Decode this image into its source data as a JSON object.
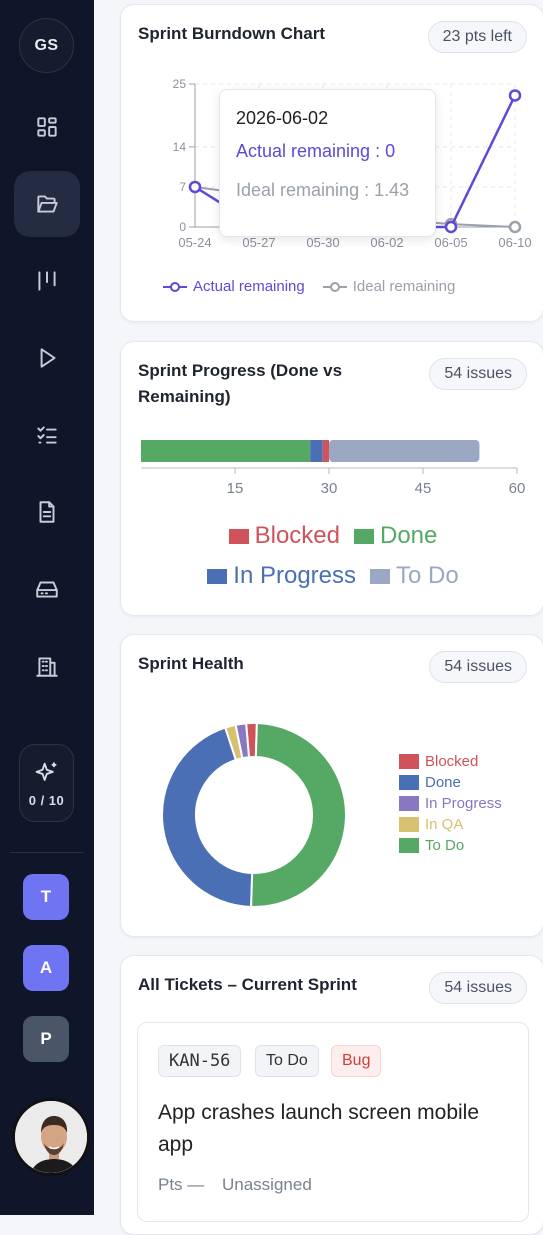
{
  "sidebar": {
    "user_initials": "GS",
    "ai_counter": "0 / 10",
    "projects": [
      "T",
      "A",
      "P"
    ]
  },
  "burndown": {
    "title": "Sprint Burndown Chart",
    "badge": "23 pts left",
    "tooltip": {
      "date": "2026-06-02",
      "actual": "Actual remaining : 0",
      "ideal": "Ideal remaining : 1.43"
    },
    "legend": {
      "actual": "Actual remaining",
      "ideal": "Ideal remaining"
    }
  },
  "progress": {
    "title_line1": "Sprint Progress (Done vs",
    "title_line2": "Remaining)",
    "badge": "54 issues",
    "legend": [
      "Blocked",
      "Done",
      "In Progress",
      "To Do"
    ]
  },
  "health": {
    "title": "Sprint Health",
    "badge": "54 issues",
    "legend": [
      "Blocked",
      "Done",
      "In Progress",
      "In QA",
      "To Do"
    ]
  },
  "tickets": {
    "title": "All Tickets – Current Sprint",
    "badge": "54 issues",
    "first": {
      "key": "KAN-56",
      "status": "To Do",
      "type": "Bug",
      "summary_line1": "App crashes launch screen mobile",
      "summary_line2": "app",
      "points": "Pts —",
      "assignee": "Unassigned"
    }
  },
  "colors": {
    "blocked": "#d0525a",
    "done": "#56a865",
    "in_progress": "#4b6fb5",
    "to_do": "#9aa8c3",
    "in_qa": "#d6c170",
    "accent": "#5b4bd6",
    "sidebar_bg": "#0f1629"
  },
  "chart_data": [
    {
      "type": "line",
      "x": [
        "05-24",
        "05-27",
        "05-30",
        "06-02",
        "06-05",
        "06-10"
      ],
      "ylim": [
        0,
        25
      ],
      "yticks": [
        0,
        7,
        14,
        25
      ],
      "series": [
        {
          "name": "Actual remaining",
          "values": [
            7,
            0,
            0,
            0,
            0,
            23
          ]
        },
        {
          "name": "Ideal remaining",
          "values": [
            7,
            5.5,
            3,
            1.43,
            0.5,
            0
          ]
        }
      ]
    },
    {
      "type": "bar",
      "orientation": "horizontal-stacked",
      "xticks": [
        15,
        30,
        45,
        60
      ],
      "series": [
        {
          "name": "Done",
          "values": [
            27
          ]
        },
        {
          "name": "In Progress",
          "values": [
            2
          ]
        },
        {
          "name": "Blocked",
          "values": [
            1
          ]
        },
        {
          "name": "To Do",
          "values": [
            24
          ]
        }
      ]
    },
    {
      "type": "pie",
      "style": "donut",
      "categories": [
        "Blocked",
        "Done",
        "In Progress",
        "In QA",
        "To Do"
      ],
      "values": [
        1,
        24,
        1,
        1,
        27
      ]
    }
  ]
}
